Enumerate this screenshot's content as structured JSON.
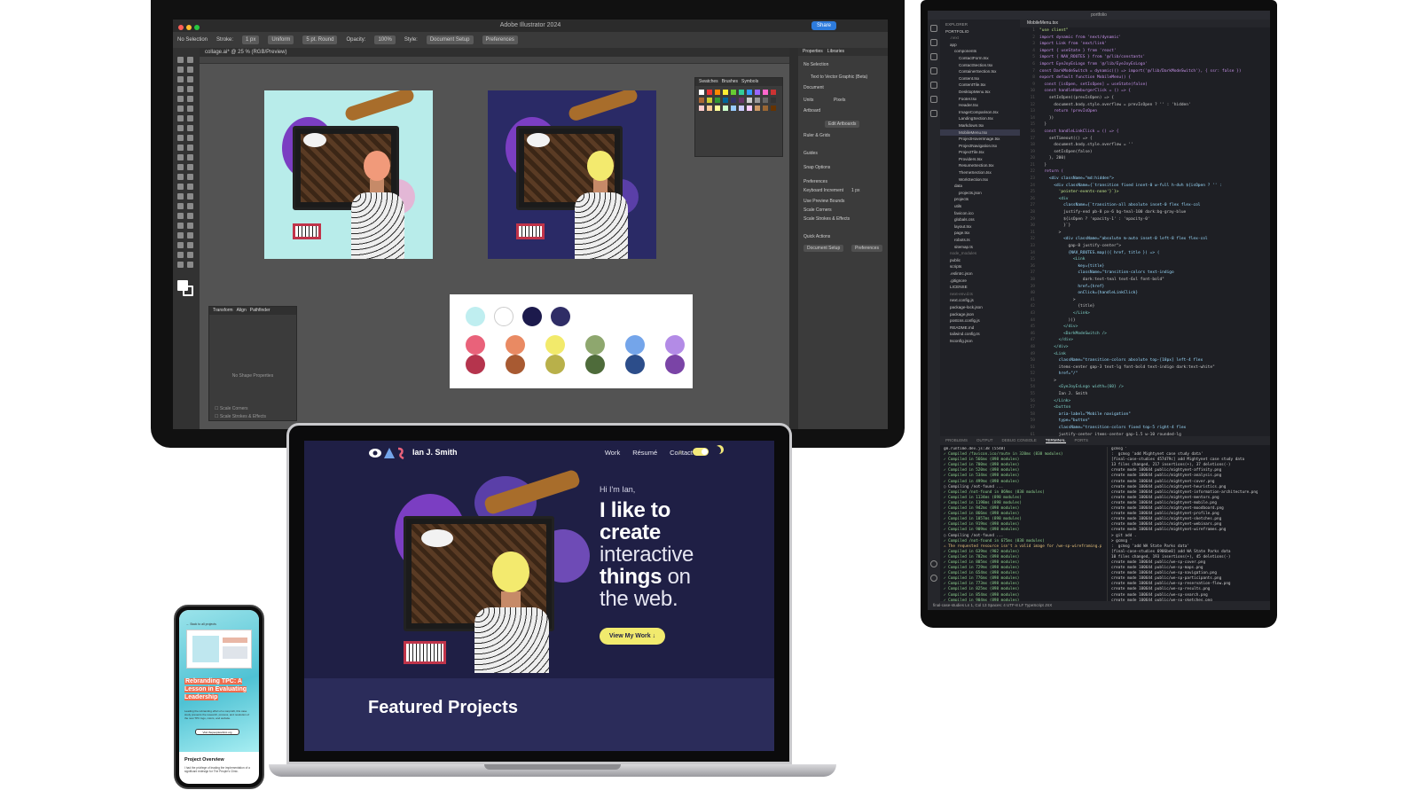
{
  "illustrator": {
    "window_title": "Adobe Illustrator 2024",
    "share": "Share",
    "control_bar": [
      "No Selection",
      "Stroke:",
      "1 px",
      "Uniform",
      "5 pt. Round",
      "Opacity:",
      "100%",
      "Style:",
      "Document Setup",
      "Preferences"
    ],
    "doc_tab": "collage.ai* @ 25 % (RGB/Preview)",
    "swatch_tabs": [
      "Swatches",
      "Brushes",
      "Symbols"
    ],
    "transform_tabs": [
      "Transform",
      "Align",
      "Pathfinder"
    ],
    "transform_empty": "No Shape Properties",
    "transform_checks": [
      "Scale Corners",
      "Scale Strokes & Effects"
    ],
    "props_tabs": [
      "Properties",
      "Libraries"
    ],
    "props_lines": [
      "No Selection",
      "Text to Vector Graphic (Beta)",
      "Document",
      "Units",
      "Pixels",
      "Artboard",
      "Edit Artboards",
      "Ruler & Grids",
      "Guides",
      "Snap Options",
      "Preferences",
      "Keyboard Increment",
      "1 px",
      "Use Preview Bounds",
      "Scale Corners",
      "Scale Strokes & Effects",
      "Quick Actions",
      "Document Setup",
      "Preferences"
    ],
    "palette_colors": [
      "#bfeef0",
      "#ffffff",
      "#1c1a4c",
      "#2f2d66",
      "#e9627a",
      "#e98a63",
      "#f2ea6b",
      "#8ea76e",
      "#74a5ea",
      "#b38be6",
      "#b5344d",
      "#a85a32",
      "#b8b04a",
      "#4e6b3a",
      "#2c4d8a",
      "#7a44a6"
    ]
  },
  "vscode": {
    "title": "portfolio",
    "explorer_title": "EXPLORER",
    "tab": "MobileMenu.tsx",
    "files": [
      "PORTFOLIO",
      ".next",
      "app",
      "components",
      "ContactForm.tsx",
      "ContactSection.tsx",
      "ContainerSection.tsx",
      "Content.tsx",
      "ContentTile.tsx",
      "DesktopMenu.tsx",
      "Footer.tsx",
      "Header.tsx",
      "ImageComparison.tsx",
      "LandingSection.tsx",
      "Markdown.tsx",
      "MobileMenu.tsx",
      "ProjectHoverImage.tsx",
      "ProjectNavigation.tsx",
      "ProjectTile.tsx",
      "Providers.tsx",
      "ResumeSection.tsx",
      "ThemeSection.tsx",
      "WorkSection.tsx",
      "data",
      "projects.json",
      "projects",
      "utils",
      "favicon.ico",
      "globals.css",
      "layout.tsx",
      "page.tsx",
      "robots.ts",
      "sitemap.ts",
      "node_modules",
      "public",
      "scripts",
      ".eslintrc.json",
      ".gitignore",
      "LICENSE",
      "next-env.d.ts",
      "next.config.js",
      "package-lock.json",
      "package.json",
      "postcss.config.js",
      "README.md",
      "tailwind.config.ts",
      "tsconfig.json",
      "OUTLINE",
      "TIMELINE"
    ],
    "code": [
      "\"use client\"",
      "",
      "import dynamic from 'next/dynamic'",
      "import Link from 'next/link'",
      "import { useState } from 'react'",
      "import { NAV_ROUTES } from '@/lib/constants'",
      "import EyeJoyEsLogo from '@/lib/EyeJoyEsLogo'",
      "",
      "const DarkModeSwitch = dynamic(() => import('@/lib/DarkModeSwitch'), { ssr: false })",
      "",
      "export default function MobileMenu() {",
      "  const [isOpen, setIsOpen] = useState(false)",
      "",
      "  const handleHamburgerClick = () => {",
      "    setIsOpen((prevIsOpen) => {",
      "      document.body.style.overflow = prevIsOpen ? '' : 'hidden'",
      "      return !prevIsOpen",
      "    })",
      "  }",
      "",
      "  const handleLinkClick = () => {",
      "    setTimeout(() => {",
      "      document.body.style.overflow = ''",
      "      setIsOpen(false)",
      "    }, 200)",
      "  }",
      "",
      "  return (",
      "    <div className=\"md:hidden\">",
      "      <div className={`transition fixed inset-0 w-full h-dvh ${isOpen ? '' :",
      "        'pointer-events-none'}`}>",
      "        <div",
      "          className={`transition-all absolute inset-0 flex flex-col",
      "          justify-end pb-8 px-6 bg-teal-100 dark:bg-gray-blue",
      "          ${isOpen ? 'opacity-1' : 'opacity-0'",
      "          }`}",
      "        >",
      "          <div className=\"absolute m-auto inset-0 left-8 flex flex-col",
      "            gap-8 justify-center\">",
      "            {NAV_ROUTES.map(({ href, title }) => (",
      "              <Link",
      "                key={title}",
      "                className=\"transition-colors text-indigo",
      "                  dark:text-teal text-6xl font-bold\"",
      "                href={href}",
      "                onClick={handleLinkClick}",
      "              >",
      "                {title}",
      "              </Link>",
      "            ))}",
      "          </div>",
      "          <DarkModeSwitch />",
      "        </div>",
      "      </div>",
      "      <Link",
      "        className=\"transition-colors absolute top-[18px] left-4 flex",
      "        items-center gap-3 text-lg font-bold text-indigo dark:text-white\"",
      "        href=\"/\"",
      "      >",
      "        <EyeJoyEsLogo width={60} />",
      "        Ian J. Smith",
      "      </Link>",
      "      <button",
      "        aria-label=\"Mobile navigation\"",
      "        type=\"button\"",
      "        className=\"transition-colors fixed top-5 right-4 flex",
      "        justify-center items-center gap-1.5 w-10 rounded-lg",
      "        dark:focus:outline-none dark:focus:ring-2 dark:focus:ring-gray-600",
      "        text-indigo dark:text-white\"",
      "        onClick={handleHamburgerClick}",
      "      >"
    ],
    "panel_tabs": [
      "PROBLEMS",
      "OUTPUT",
      "DEBUG CONSOLE",
      "TERMINAL",
      "PORTS"
    ],
    "terminal_left": [
      "gm.runtime.dev.js:38 (5548)",
      "✓ Compiled /favicon.ico/route in 320ms (838 modules)",
      "✓ Compiled in 566ms (898 modules)",
      "✓ Compiled in 700ms (898 modules)",
      "✓ Compiled in 520ms (898 modules)",
      "✓ Compiled in 534ms (898 modules)",
      "✓ Compiled in 499ms (898 modules)",
      "○ Compiling /not-found ...",
      "✓ Compiled /not-found in 869ms (838 modules)",
      "✓ Compiled in 1134ms (898 modules)",
      "✓ Compiled in 1198ms (898 modules)",
      "✓ Compiled in 942ms (898 modules)",
      "✓ Compiled in 866ms (898 modules)",
      "✓ Compiled in 1057ms (898 modules)",
      "✓ Compiled in 919ms (898 modules)",
      "✓ Compiled in 909ms (898 modules)",
      "○ Compiling /not-found ...",
      "✓ Compiled /not-found in 675ms (838 modules)",
      "⚠ The requested resource isn't a valid image for /we-sp-wireframing.png received text/html; charset=utf-8",
      "✓ Compiled in 639ms (902 modules)",
      "✓ Compiled in 782ms (898 modules)",
      "✓ Compiled in 805ms (898 modules)",
      "✓ Compiled in 729ms (898 modules)",
      "✓ Compiled in 654ms (898 modules)",
      "✓ Compiled in 776ms (898 modules)",
      "✓ Compiled in 773ms (898 modules)",
      "✓ Compiled in 825ms (898 modules)",
      "✓ Compiled in 854ms (898 modules)",
      "✓ Compiled in 904ms (898 modules)"
    ],
    "terminal_right": [
      "gcmsg '",
      ":  gcmsg 'add Mightynet case study data'",
      "[final-case-studies 457d79c] add Mightynet case study data",
      "13 files changed, 217 insertions(+), 37 deletions(-)",
      "create mode 100644 public/mightynet-affinity.png",
      "create mode 100644 public/mightynet-analysis.png",
      "create mode 100644 public/mightynet-cover.png",
      "create mode 100644 public/mightynet-heuristics.png",
      "create mode 100644 public/mightynet-information-architecture.png",
      "create mode 100644 public/mightynet-mentors.png",
      "create mode 100644 public/mightynet-mobile.png",
      "create mode 100644 public/mightynet-moodboard.png",
      "create mode 100644 public/mightynet-profile.png",
      "create mode 100644 public/mightynet-sketches.png",
      "create mode 100644 public/mightynet-webinars.png",
      "create mode 100644 public/mightynet-wireframes.png",
      "> git add .",
      "> gcmsg '",
      ":  gcmsg 'add WA State Parks data'",
      "[final-case-studies 6906be0] add WA State Parks data",
      "10 files changed, 193 insertions(+), 45 deletions(-)",
      "create mode 100644 public/we-sp-cover.png",
      "create mode 100644 public/we-sp-maps.png",
      "create mode 100644 public/we-sp-navigation.png",
      "create mode 100644 public/we-sp-participants.png",
      "create mode 100644 public/we-sp-reservation-flow.png",
      "create mode 100644 public/we-sp-results.png",
      "create mode 100644 public/we-sp-search.png",
      "create mode 100644 public/we-sp-sketches.png",
      "create mode 100644 public/we-sp-wireframes.png",
      "",
      "~/Projects/portfolio final-case-studies"
    ],
    "status": "final-case-studies    Ln 1, Col 13   Spaces: 4   UTF-8   LF   TypeScript JSX"
  },
  "website": {
    "name": "Ian J. Smith",
    "nav": [
      "Work",
      "Résumé",
      "Contact"
    ],
    "greeting": "Hi I'm Ian,",
    "hero": [
      {
        "text": "I like to",
        "style": "b"
      },
      {
        "text": "create",
        "style": "b"
      },
      {
        "text": "interactive",
        "style": "l"
      },
      {
        "text": "things",
        "style": "b",
        "tail": " on"
      },
      {
        "text": "the web.",
        "style": "l"
      }
    ],
    "cta": "View My Work ↓",
    "featured": "Featured Projects",
    "accent": "#f1ea6e",
    "bg": "#1f1f45"
  },
  "phone": {
    "back": "← Back to all projects",
    "title_hl": "Rebranding TPC: A Lesson in Evaluating Leadership",
    "body": "Leading the rebranding effort of a nonprofit, this case study presents the research, process, and resolution of the new TPC logo, colors, and website.",
    "button": "Visit thepeoplesclinic.org",
    "overview_title": "Project Overview",
    "overview_text": "I had the privilege of leading the implementation of a significant redesign for The People's Clinic."
  }
}
